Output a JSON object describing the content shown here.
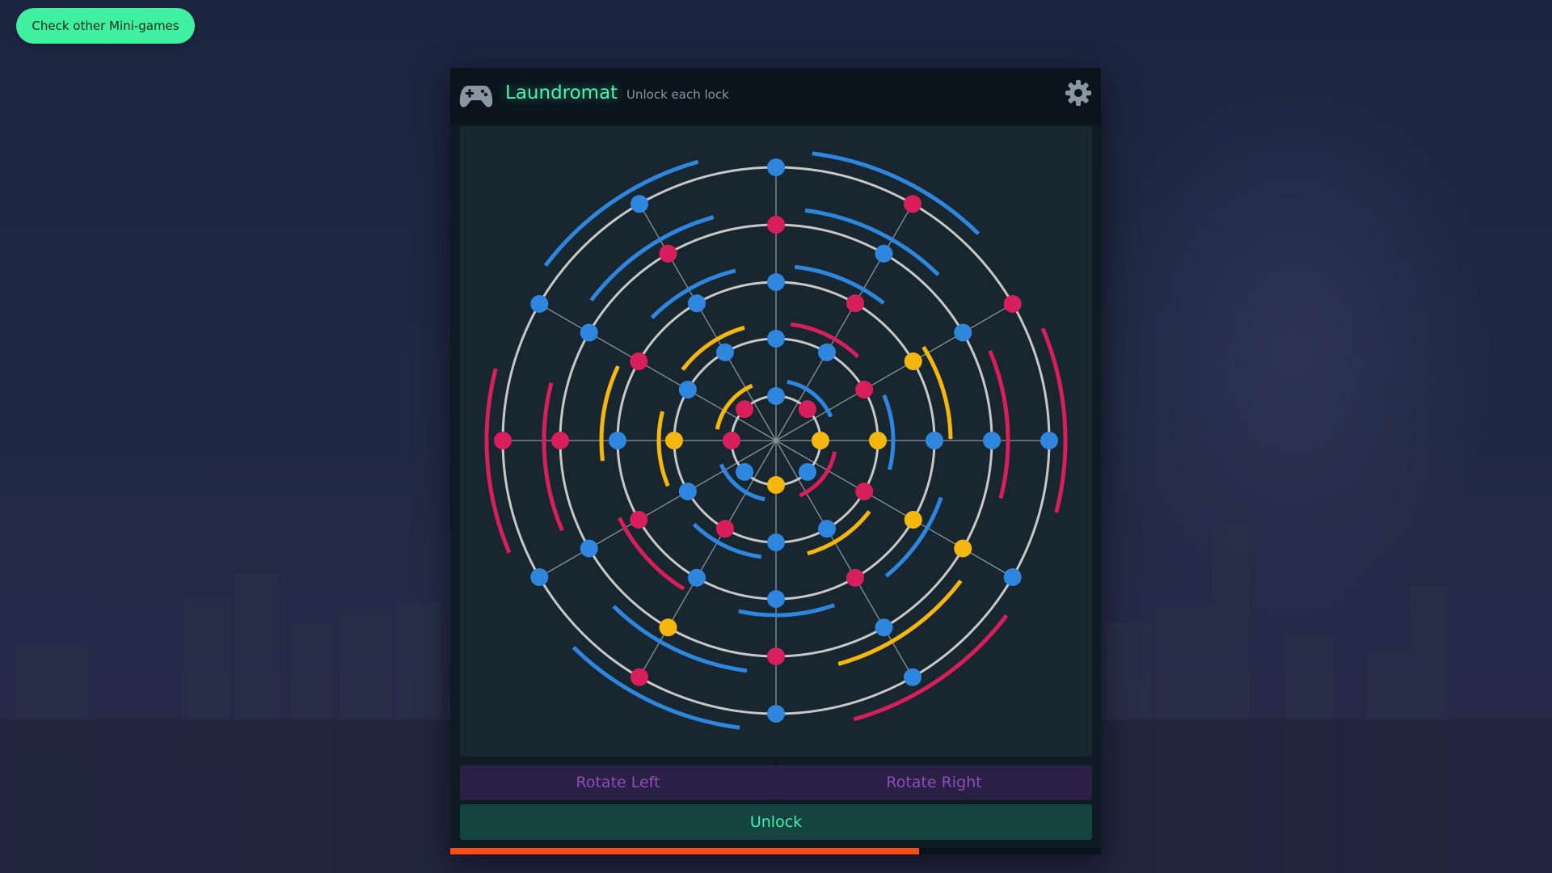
{
  "header_button": {
    "label": "Check other Mini-games"
  },
  "game": {
    "title": "Laundromat",
    "subtitle": "Unlock each lock"
  },
  "controls": {
    "rotate_left": "Rotate Left",
    "rotate_right": "Rotate Right",
    "unlock": "Unlock"
  },
  "progress": {
    "fraction": 0.72
  },
  "icons": {
    "game": "gamepad-icon",
    "settings": "gear-icon"
  },
  "colors": {
    "blue": "#2e86de",
    "red": "#d81f5c",
    "yellow": "#f5b70e",
    "ring": "#c8c8c8",
    "accent": "#3ff0a0",
    "progress": "#ff4a12"
  },
  "lock": {
    "spokes": 12,
    "rings": [
      {
        "nodes": [
          "blue",
          "red",
          "yellow",
          "blue",
          "yellow",
          "blue",
          "red",
          "red"
        ]
      },
      {
        "nodes": [
          "blue",
          "blue",
          "red",
          "yellow",
          "red",
          "blue",
          "blue",
          "red",
          "blue",
          "yellow",
          "blue",
          "blue"
        ]
      },
      {
        "nodes": [
          "blue",
          "red",
          "yellow",
          "blue",
          "yellow",
          "red",
          "blue",
          "blue",
          "red",
          "blue",
          "red",
          "blue"
        ]
      },
      {
        "nodes": [
          "red",
          "blue",
          "blue",
          "blue",
          "yellow",
          "blue",
          "red",
          "yellow",
          "blue",
          "red",
          "blue",
          "red"
        ]
      },
      {
        "nodes": [
          "blue",
          "red",
          "red",
          "blue",
          "blue",
          "blue",
          "blue",
          "red",
          "blue",
          "red",
          "blue",
          "blue"
        ]
      }
    ],
    "arcs": [
      {
        "ring": 0,
        "segments": [
          "blue",
          "red",
          "blue",
          "yellow"
        ]
      },
      {
        "ring": 1,
        "segments": [
          "red",
          "blue",
          "yellow",
          "blue",
          "yellow",
          "yellow"
        ]
      },
      {
        "ring": 2,
        "segments": [
          "blue",
          "yellow",
          "blue",
          "blue",
          "red",
          "yellow",
          "blue"
        ]
      },
      {
        "ring": 3,
        "segments": [
          "blue",
          "red",
          "yellow",
          "blue",
          "red",
          "blue"
        ]
      },
      {
        "ring": 4,
        "segments": [
          "blue",
          "red",
          "red",
          "blue",
          "red",
          "blue"
        ]
      }
    ]
  }
}
